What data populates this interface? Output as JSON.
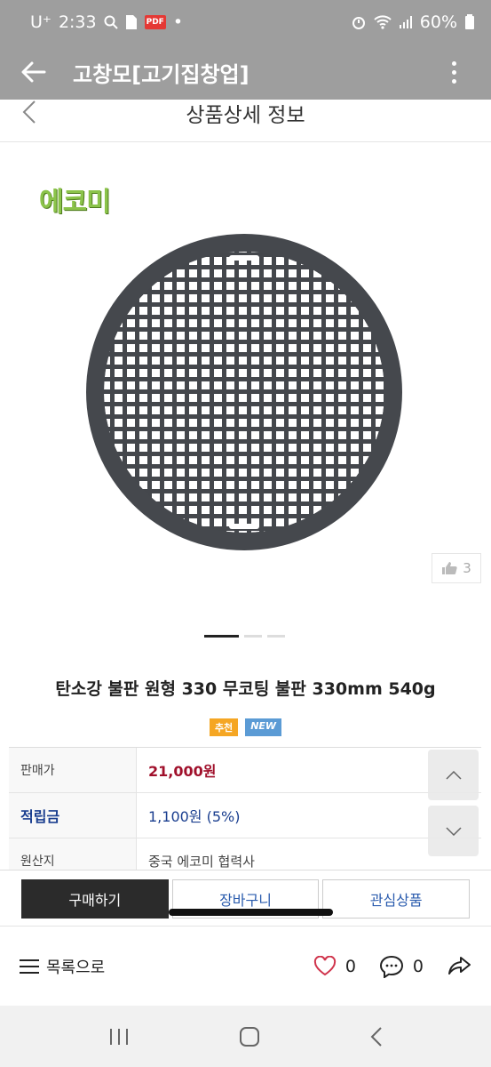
{
  "status_bar": {
    "carrier": "U⁺",
    "time": "2:33",
    "pdf_label": "PDF",
    "dot": "•",
    "battery": "60%"
  },
  "app_bar": {
    "title": "고창모[고기집창업]"
  },
  "page_header": {
    "title": "상품상세 정보"
  },
  "product": {
    "logo_text": "에코미",
    "like_count": "3",
    "name": "탄소강 불판 원형 330 무코팅 불판 330mm 540g",
    "badges": {
      "recommend": "추천",
      "new": "NEW"
    },
    "info": [
      {
        "key": "판매가",
        "value": "21,000원"
      },
      {
        "key": "적립금",
        "value": "1,100원 (5%)"
      },
      {
        "key": "원산지",
        "value": "중국 에코미 협력사"
      }
    ],
    "slides_total": 3,
    "slide_active": 1
  },
  "actions": {
    "buy": "구매하기",
    "cart": "장바구니",
    "wishlist": "관심상품"
  },
  "bottom_bar": {
    "list_label": "목록으로",
    "like_count": "0",
    "comment_count": "0"
  },
  "colors": {
    "status_bg": "#9e9e9e",
    "price": "#a0102b",
    "points": "#1a3e8f",
    "buy_bg": "#2b2b2b"
  }
}
